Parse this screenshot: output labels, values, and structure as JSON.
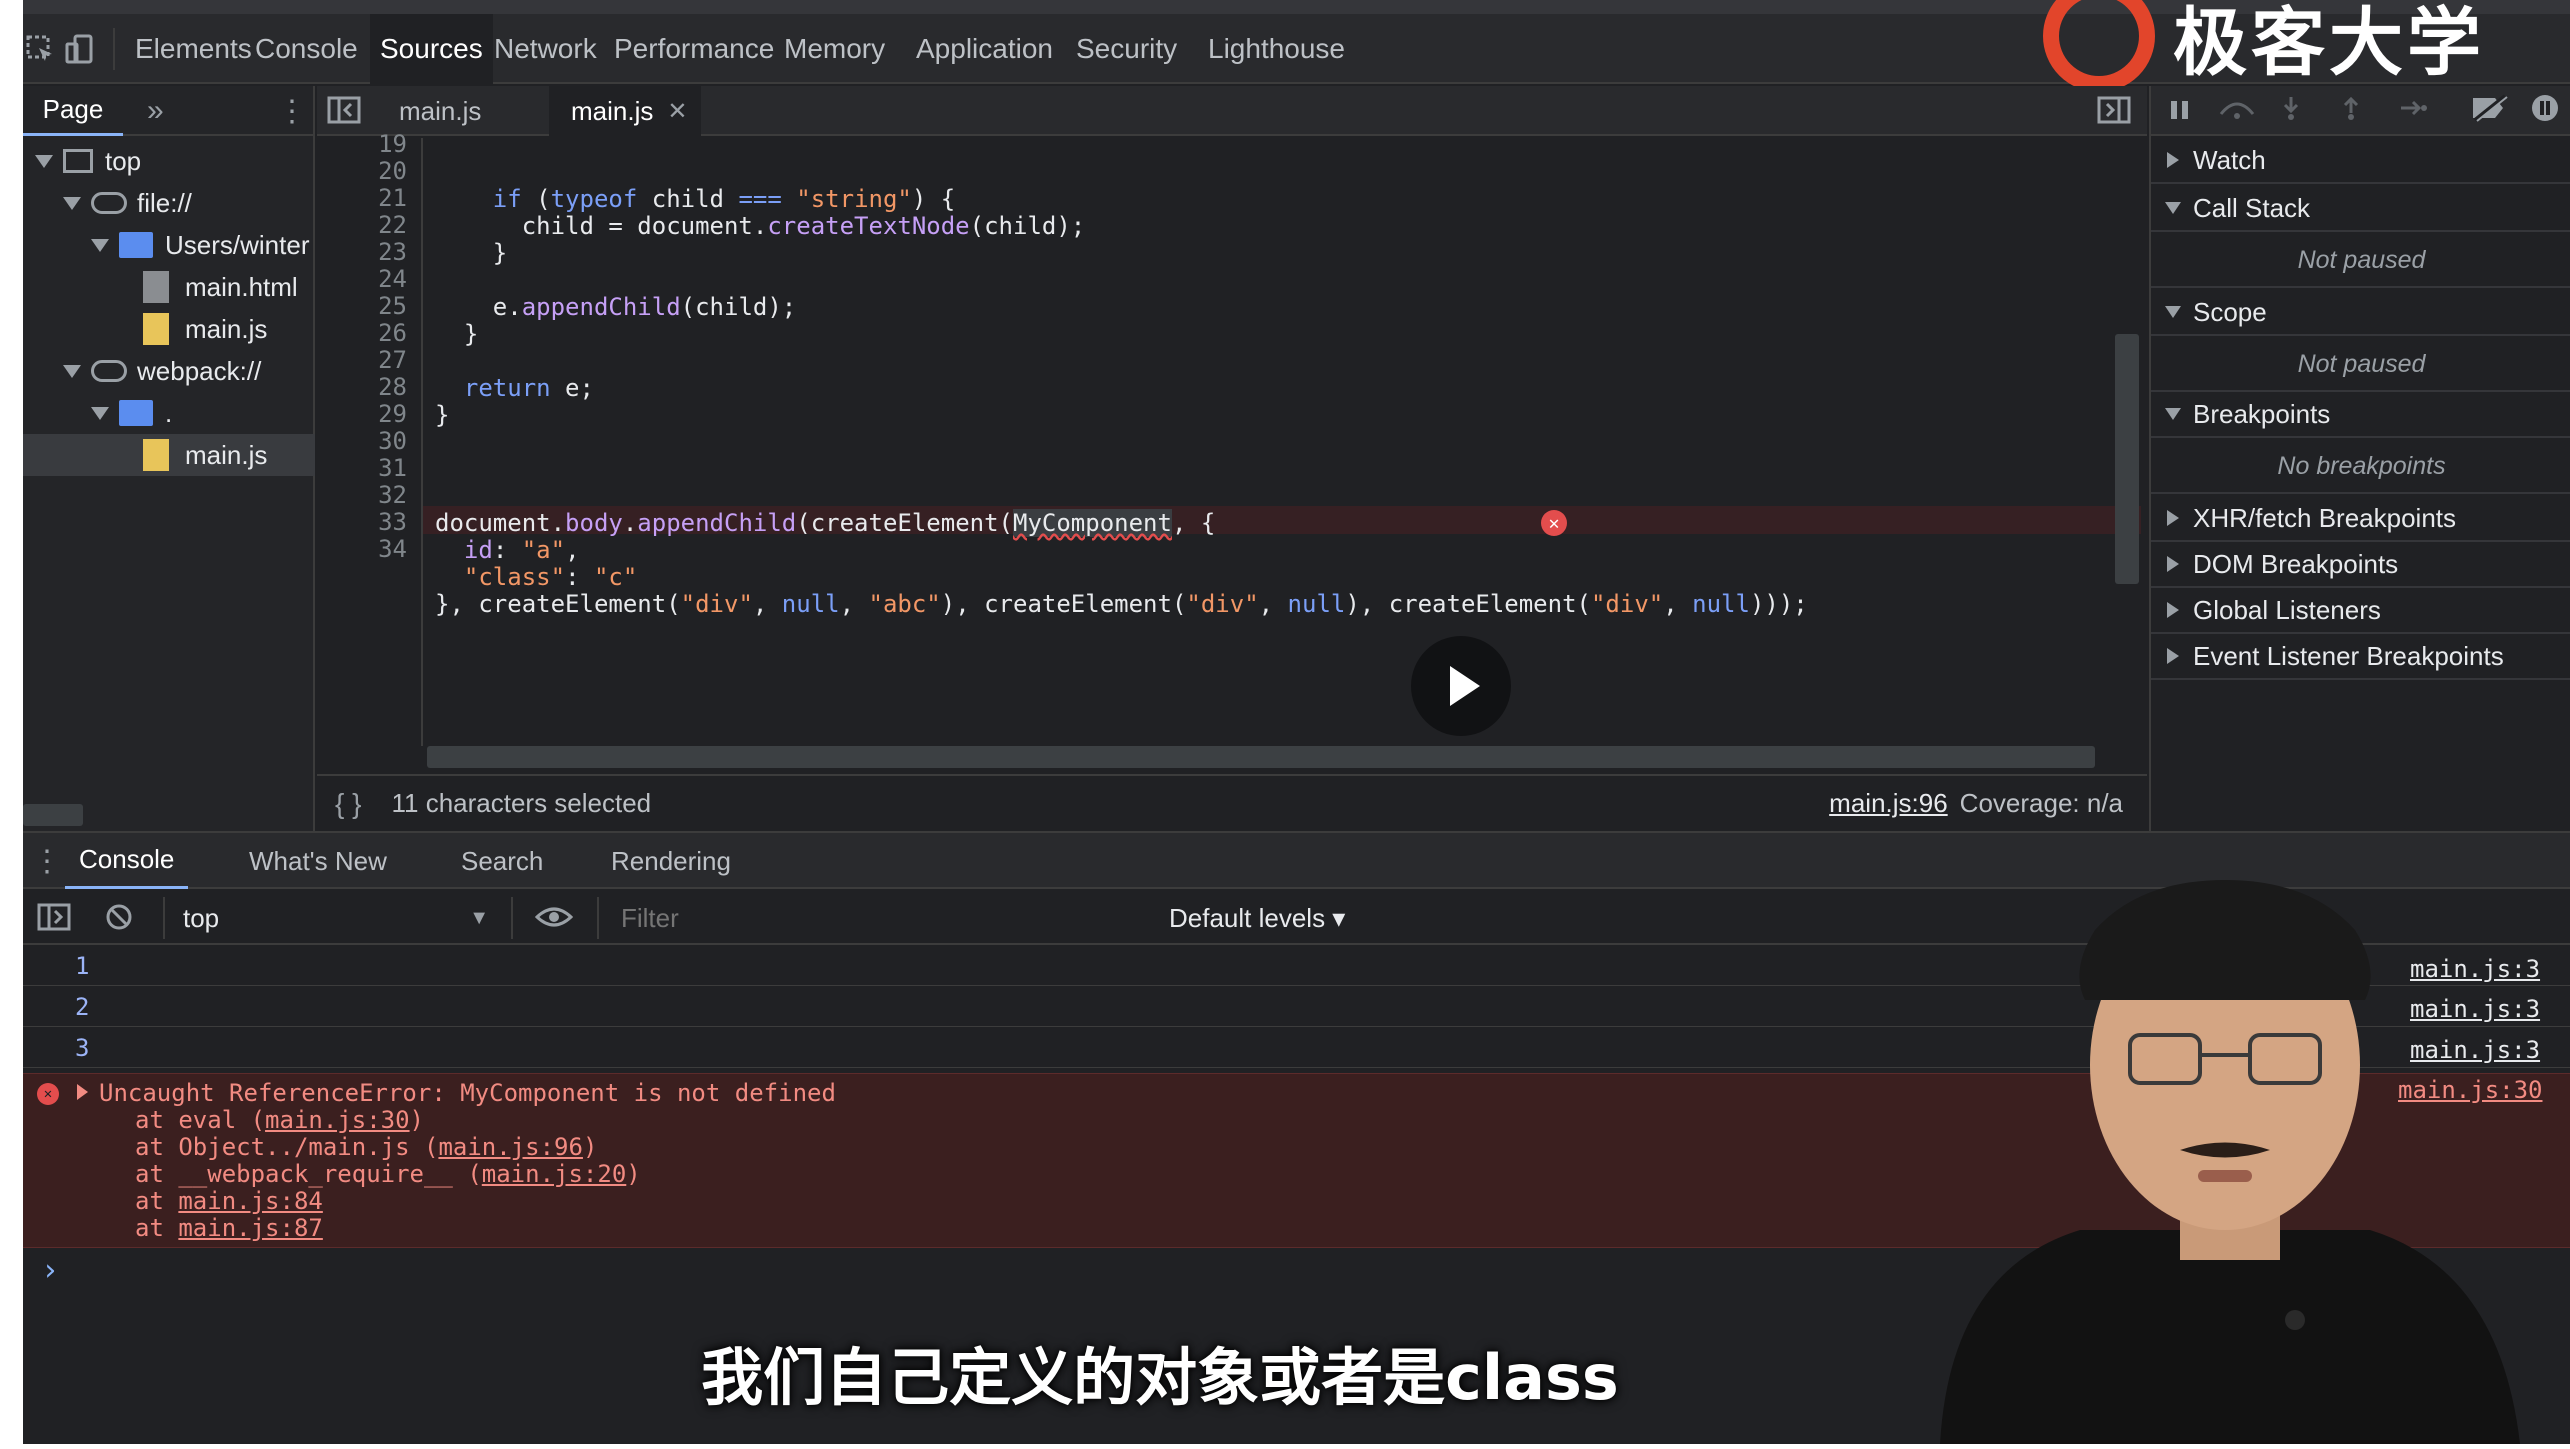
{
  "main_tabs": [
    "Elements",
    "Console",
    "Sources",
    "Network",
    "Performance",
    "Memory",
    "Application",
    "Security",
    "Lighthouse"
  ],
  "active_main_tab": "Sources",
  "logo_text": "极客大学",
  "navigator": {
    "tab": "Page",
    "more": "»",
    "tree": [
      {
        "label": "top",
        "icon": "frame-icon",
        "depth": 0
      },
      {
        "label": "file://",
        "icon": "cloud-icon",
        "depth": 1
      },
      {
        "label": "Users/winter",
        "icon": "folder-icon",
        "depth": 2
      },
      {
        "label": "main.html",
        "icon": "html-file-icon",
        "depth": 3
      },
      {
        "label": "main.js",
        "icon": "js-file-icon",
        "depth": 3
      },
      {
        "label": "webpack://",
        "icon": "cloud-icon",
        "depth": 1
      },
      {
        "label": ".",
        "icon": "folder-icon",
        "depth": 2
      },
      {
        "label": "main.js",
        "icon": "js-file-icon",
        "depth": 3,
        "selected": true
      }
    ]
  },
  "editor": {
    "tabs": [
      {
        "label": "main.js",
        "closable": false
      },
      {
        "label": "main.js",
        "closable": true,
        "active": true
      }
    ],
    "line_numbers": [
      "19",
      "20",
      "21",
      "22",
      "23",
      "24",
      "25",
      "26",
      "27",
      "28",
      "29",
      "30",
      "31",
      "32",
      "33",
      "34"
    ],
    "status_left": "11 characters selected",
    "status_link": "main.js:96",
    "status_coverage": "Coverage: n/a",
    "pretty_print": "{ }"
  },
  "debugger": {
    "sections": [
      {
        "title": "Watch",
        "expanded": false
      },
      {
        "title": "Call Stack",
        "expanded": true,
        "note": "Not paused"
      },
      {
        "title": "Scope",
        "expanded": true,
        "note": "Not paused"
      },
      {
        "title": "Breakpoints",
        "expanded": true,
        "note": "No breakpoints"
      },
      {
        "title": "XHR/fetch Breakpoints",
        "expanded": false
      },
      {
        "title": "DOM Breakpoints",
        "expanded": false
      },
      {
        "title": "Global Listeners",
        "expanded": false
      },
      {
        "title": "Event Listener Breakpoints",
        "expanded": false
      }
    ]
  },
  "drawer": {
    "tabs": [
      "Console",
      "What's New",
      "Search",
      "Rendering"
    ],
    "active_tab": "Console",
    "context": "top",
    "filter_placeholder": "Filter",
    "levels": "Default levels ▾",
    "logs": [
      {
        "text": "1",
        "source": "main.js:3"
      },
      {
        "text": "2",
        "source": "main.js:3"
      },
      {
        "text": "3",
        "source": "main.js:3"
      }
    ],
    "error": {
      "message": "Uncaught ReferenceError: MyComponent is not defined",
      "source": "main.js:30",
      "stack": [
        {
          "prefix": "at eval (",
          "link": "main.js:30",
          "suffix": ")"
        },
        {
          "prefix": "at Object../main.js (",
          "link": "main.js:96",
          "suffix": ")"
        },
        {
          "prefix": "at __webpack_require__ (",
          "link": "main.js:20",
          "suffix": ")"
        },
        {
          "prefix": "at ",
          "link": "main.js:84",
          "suffix": ""
        },
        {
          "prefix": "at ",
          "link": "main.js:87",
          "suffix": ""
        }
      ]
    },
    "prompt": "›"
  },
  "subtitle": "我们自己定义的对象或者是class",
  "colors": {
    "accent_red": "#e34d4d",
    "link_blue": "#9cb4f7",
    "logo_red": "#e2452b"
  }
}
